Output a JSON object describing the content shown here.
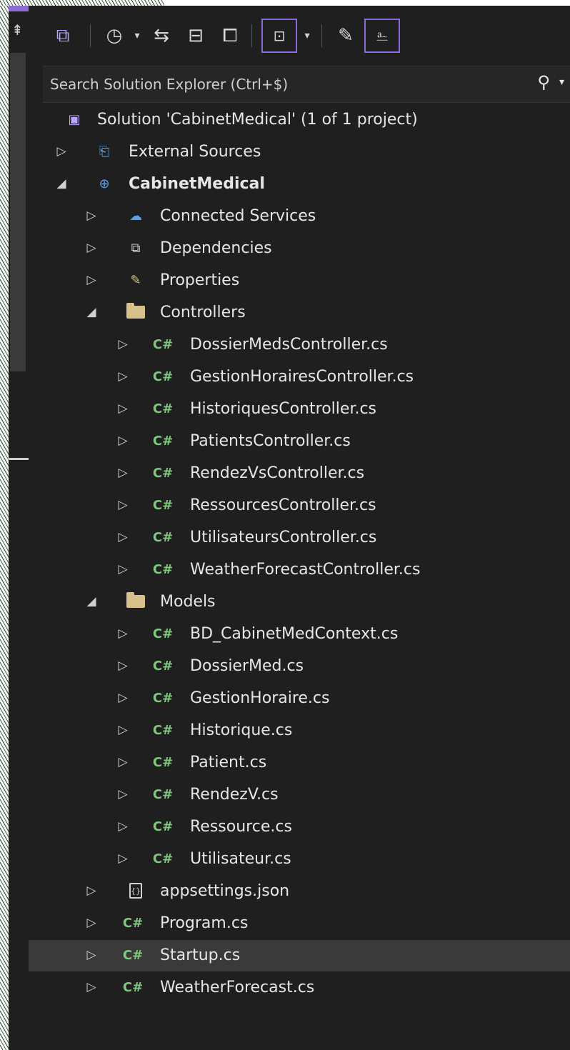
{
  "toolbar": {
    "buttons": [
      {
        "icon": "vs-project-icon"
      },
      {
        "icon": "history-icon"
      },
      {
        "icon": "dropdown-caret-icon"
      },
      {
        "icon": "sync-icon"
      },
      {
        "icon": "collapse-all-icon"
      },
      {
        "icon": "show-all-files-icon"
      },
      {
        "icon": "switch-view-icon"
      },
      {
        "icon": "dropdown-caret-icon"
      },
      {
        "icon": "properties-wrench-icon"
      },
      {
        "icon": "preview-selected-icon"
      }
    ]
  },
  "search": {
    "placeholder": "Search Solution Explorer (Ctrl+$)"
  },
  "tree": {
    "solution": "Solution 'CabinetMedical' (1 of 1 project)",
    "external_sources": "External Sources",
    "project": "CabinetMedical",
    "connected_services": "Connected Services",
    "dependencies": "Dependencies",
    "properties": "Properties",
    "controllers_folder": "Controllers",
    "controllers": [
      "DossierMedsController.cs",
      "GestionHorairesController.cs",
      "HistoriquesController.cs",
      "PatientsController.cs",
      "RendezVsController.cs",
      "RessourcesController.cs",
      "UtilisateursController.cs",
      "WeatherForecastController.cs"
    ],
    "models_folder": "Models",
    "models": [
      "BD_CabinetMedContext.cs",
      "DossierMed.cs",
      "GestionHoraire.cs",
      "Historique.cs",
      "Patient.cs",
      "RendezV.cs",
      "Ressource.cs",
      "Utilisateur.cs"
    ],
    "appsettings": "appsettings.json",
    "program": "Program.cs",
    "startup": "Startup.cs",
    "weather": "WeatherForecast.cs",
    "cs_badge": "C#",
    "json_badge": "{}",
    "arrow_collapsed": "▷",
    "arrow_expanded": "◢"
  },
  "colors": {
    "background": "#1f1f1f",
    "selection": "#3a3a3a",
    "accent": "#8b6bd6",
    "csharp": "#7fc97f",
    "folder": "#d7c08a",
    "text": "#e6e6e6"
  }
}
